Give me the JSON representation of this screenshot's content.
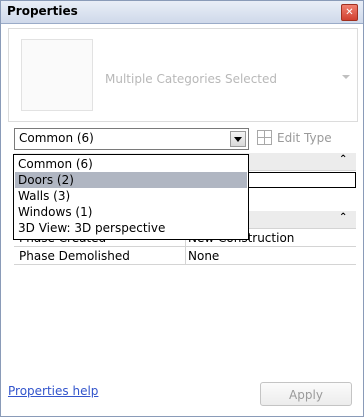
{
  "window": {
    "title": "Properties",
    "close_glyph": "✕"
  },
  "type_selector": {
    "label": "Multiple Categories Selected",
    "thumbnail_icon": "type-thumbnail",
    "arrow_icon": "chevron-down-icon"
  },
  "filter": {
    "value": "Common (6)",
    "edit_type_label": "Edit Type"
  },
  "dropdown": {
    "items": [
      {
        "label": "Common (6)",
        "selected": false
      },
      {
        "label": "Doors (2)",
        "selected": true
      },
      {
        "label": "Walls (3)",
        "selected": false
      },
      {
        "label": "Windows (1)",
        "selected": false
      },
      {
        "label": "3D View: 3D perspective",
        "selected": false
      }
    ]
  },
  "grid": {
    "group1": {
      "collapse_glyph": "⌃"
    },
    "group2": {
      "collapse_glyph": "⌃"
    },
    "rows": [
      {
        "name": "Phase Created",
        "value": "New Construction"
      },
      {
        "name": "Phase Demolished",
        "value": "None"
      }
    ]
  },
  "footer": {
    "help_label": "Properties help",
    "apply_label": "Apply"
  },
  "colors": {
    "title_bar": "#cfd9ea",
    "close_button": "#d04030",
    "selection": "#b0b6c2",
    "link": "#3355cc"
  }
}
